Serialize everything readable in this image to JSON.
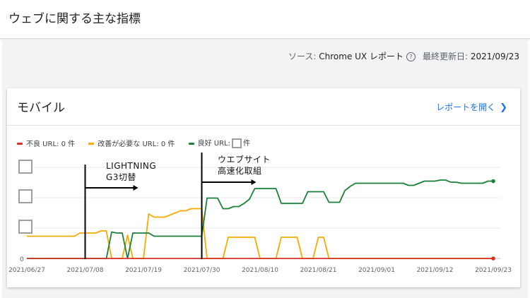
{
  "page": {
    "title": "ウェブに関する主な指標"
  },
  "source": {
    "label": "ソース: ",
    "value": "Chrome UX レポート",
    "help_icon": "help-circle-icon",
    "updated_label": "最終更新日: ",
    "updated_value": "2021/09/23"
  },
  "card": {
    "title": "モバイル",
    "open_report_label": "レポートを開く",
    "open_report_icon": "chevron-right-icon"
  },
  "legend": [
    {
      "label": "不良 URL: 0 件",
      "color": "#d93025"
    },
    {
      "label": "改善が必要な URL: 0 件",
      "color": "#f9ab00"
    },
    {
      "label_prefix": "良好 URL:",
      "label_suffix": "件",
      "color": "#188038"
    }
  ],
  "annotations": [
    {
      "line1": "LIGHTNING",
      "line2": "G3切替",
      "date": "2021/07/08"
    },
    {
      "line1": "ウエブサイト",
      "line2": "高速化取組",
      "date": "2021/07/30"
    }
  ],
  "chart_data": {
    "type": "line",
    "x": [
      "2021/06/27",
      "2021/06/28",
      "2021/06/29",
      "2021/06/30",
      "2021/07/01",
      "2021/07/02",
      "2021/07/03",
      "2021/07/04",
      "2021/07/05",
      "2021/07/06",
      "2021/07/07",
      "2021/07/08",
      "2021/07/09",
      "2021/07/10",
      "2021/07/11",
      "2021/07/12",
      "2021/07/13",
      "2021/07/14",
      "2021/07/15",
      "2021/07/16",
      "2021/07/17",
      "2021/07/18",
      "2021/07/19",
      "2021/07/20",
      "2021/07/21",
      "2021/07/22",
      "2021/07/23",
      "2021/07/24",
      "2021/07/25",
      "2021/07/26",
      "2021/07/27",
      "2021/07/28",
      "2021/07/29",
      "2021/07/30",
      "2021/07/31",
      "2021/08/01",
      "2021/08/02",
      "2021/08/03",
      "2021/08/04",
      "2021/08/05",
      "2021/08/06",
      "2021/08/07",
      "2021/08/08",
      "2021/08/09",
      "2021/08/10",
      "2021/08/11",
      "2021/08/12",
      "2021/08/13",
      "2021/08/14",
      "2021/08/15",
      "2021/08/16",
      "2021/08/17",
      "2021/08/18",
      "2021/08/19",
      "2021/08/20",
      "2021/08/21",
      "2021/08/22",
      "2021/08/23",
      "2021/08/24",
      "2021/08/25",
      "2021/08/26",
      "2021/08/27",
      "2021/08/28",
      "2021/08/29",
      "2021/08/30",
      "2021/08/31",
      "2021/09/01",
      "2021/09/02",
      "2021/09/03",
      "2021/09/04",
      "2021/09/05",
      "2021/09/06",
      "2021/09/07",
      "2021/09/08",
      "2021/09/09",
      "2021/09/10",
      "2021/09/11",
      "2021/09/12",
      "2021/09/13",
      "2021/09/14",
      "2021/09/15",
      "2021/09/16",
      "2021/09/17",
      "2021/09/18",
      "2021/09/19",
      "2021/09/20",
      "2021/09/21",
      "2021/09/22",
      "2021/09/23"
    ],
    "x_ticks": [
      "2021/06/27",
      "2021/07/08",
      "2021/07/19",
      "2021/07/30",
      "2021/08/10",
      "2021/08/21",
      "2021/09/01",
      "2021/09/12",
      "2021/09/23"
    ],
    "y_zero_label": "0",
    "y_hidden_tick_count": 3,
    "ylim": [
      0,
      100
    ],
    "grid": true,
    "legend_position": "top-left",
    "series": [
      {
        "name": "不良 URL: 0 件",
        "color": "#d93025",
        "values": [
          0,
          0,
          0,
          0,
          0,
          0,
          0,
          0,
          0,
          0,
          0,
          0,
          0,
          0,
          0,
          0,
          0,
          0,
          0,
          0,
          0,
          0,
          0,
          0,
          0,
          0,
          0,
          0,
          0,
          0,
          0,
          0,
          0,
          0,
          0,
          0,
          0,
          0,
          0,
          0,
          0,
          0,
          0,
          0,
          0,
          0,
          0,
          0,
          0,
          0,
          0,
          0,
          0,
          0,
          0,
          0,
          0,
          0,
          0,
          0,
          0,
          0,
          0,
          0,
          0,
          0,
          0,
          0,
          0,
          0,
          0,
          0,
          0,
          0,
          0,
          0,
          0,
          0,
          0,
          0,
          0,
          0,
          0,
          0,
          0,
          0,
          0,
          0,
          0
        ]
      },
      {
        "name": "改善が必要な URL: 0 件",
        "color": "#f9ab00",
        "values": [
          21,
          21,
          21,
          21,
          21,
          21,
          21,
          21,
          21,
          21,
          24,
          24,
          24,
          24,
          26,
          26,
          0,
          0,
          0,
          22,
          0,
          0,
          0,
          42,
          39,
          39,
          39,
          41,
          43,
          45,
          45,
          47,
          47,
          47,
          0,
          0,
          0,
          0,
          20,
          20,
          20,
          20,
          20,
          20,
          0,
          0,
          0,
          0,
          20,
          20,
          20,
          20,
          0,
          0,
          0,
          20,
          20,
          0,
          0,
          0,
          0,
          0,
          0,
          0,
          0,
          0,
          0,
          0,
          0,
          0,
          0,
          0,
          0,
          0,
          0,
          0,
          0,
          0,
          0,
          0,
          0,
          0,
          0,
          0,
          0,
          0,
          0,
          0,
          0
        ]
      },
      {
        "name": "良好 URL",
        "color": "#188038",
        "values": [
          0,
          0,
          0,
          0,
          0,
          0,
          0,
          0,
          0,
          0,
          0,
          0,
          0,
          0,
          0,
          0,
          25,
          24,
          24,
          0,
          24,
          24,
          24,
          24,
          21,
          21,
          21,
          21,
          21,
          21,
          21,
          21,
          21,
          21,
          57,
          57,
          57,
          47,
          47,
          49,
          49,
          52,
          56,
          66,
          66,
          66,
          66,
          66,
          52,
          52,
          52,
          52,
          52,
          63,
          63,
          63,
          63,
          53,
          53,
          53,
          64,
          68,
          71,
          71,
          71,
          71,
          71,
          71,
          71,
          71,
          71,
          71,
          69,
          69,
          71,
          73,
          73,
          73,
          74,
          74,
          72,
          72,
          71,
          71,
          71,
          71,
          71,
          73,
          73
        ]
      }
    ]
  }
}
